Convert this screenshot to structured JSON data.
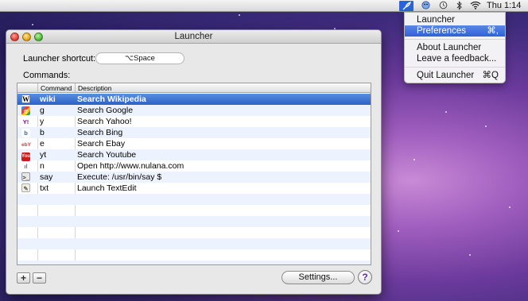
{
  "menubar": {
    "launcher_icon_label": "🚀",
    "clock": "Thu 1:14",
    "icons": [
      "launcher-rocket-icon",
      "smiley-icon",
      "time-machine-icon",
      "bluetooth-icon",
      "wifi-icon"
    ]
  },
  "dropdown": {
    "items": [
      {
        "label": "Launcher",
        "shortcut": "",
        "highlighted": false
      },
      {
        "label": "Preferences",
        "shortcut": "⌘,",
        "highlighted": true
      },
      {
        "label": "About Launcher",
        "shortcut": "",
        "highlighted": false
      },
      {
        "label": "Leave a feedback...",
        "shortcut": "",
        "highlighted": false
      },
      {
        "label": "Quit Launcher",
        "shortcut": "⌘Q",
        "highlighted": false
      }
    ]
  },
  "window": {
    "title": "Launcher",
    "shortcut_label": "Launcher shortcut:",
    "shortcut_value": "⌥Space",
    "commands_label": "Commands:",
    "columns": {
      "command": "Command",
      "description": "Description"
    },
    "rows": [
      {
        "icon": "wikipedia-icon",
        "glyph": "W",
        "cmd": "wiki",
        "desc": "Search Wikipedia",
        "selected": true
      },
      {
        "icon": "google-icon",
        "glyph": "g",
        "cmd": "g",
        "desc": "Search Google",
        "selected": false
      },
      {
        "icon": "yahoo-icon",
        "glyph": "Y!",
        "cmd": "y",
        "desc": "Search Yahoo!",
        "selected": false
      },
      {
        "icon": "bing-icon",
        "glyph": "b",
        "cmd": "b",
        "desc": "Search Bing",
        "selected": false
      },
      {
        "icon": "ebay-icon",
        "glyph": "ebY",
        "cmd": "e",
        "desc": "Search Ebay",
        "selected": false
      },
      {
        "icon": "youtube-icon",
        "glyph": "You",
        "cmd": "yt",
        "desc": "Search Youtube",
        "selected": false
      },
      {
        "icon": "nulana-icon",
        "glyph": "ıl",
        "cmd": "n",
        "desc": "Open http://www.nulana.com",
        "selected": false
      },
      {
        "icon": "terminal-icon",
        "glyph": ">_",
        "cmd": "say",
        "desc": "Execute: /usr/bin/say $",
        "selected": false
      },
      {
        "icon": "textedit-icon",
        "glyph": "✎",
        "cmd": "txt",
        "desc": "Launch TextEdit",
        "selected": false
      }
    ],
    "empty_rows": 7,
    "add_label": "+",
    "remove_label": "−",
    "settings_label": "Settings...",
    "help_label": "?"
  }
}
